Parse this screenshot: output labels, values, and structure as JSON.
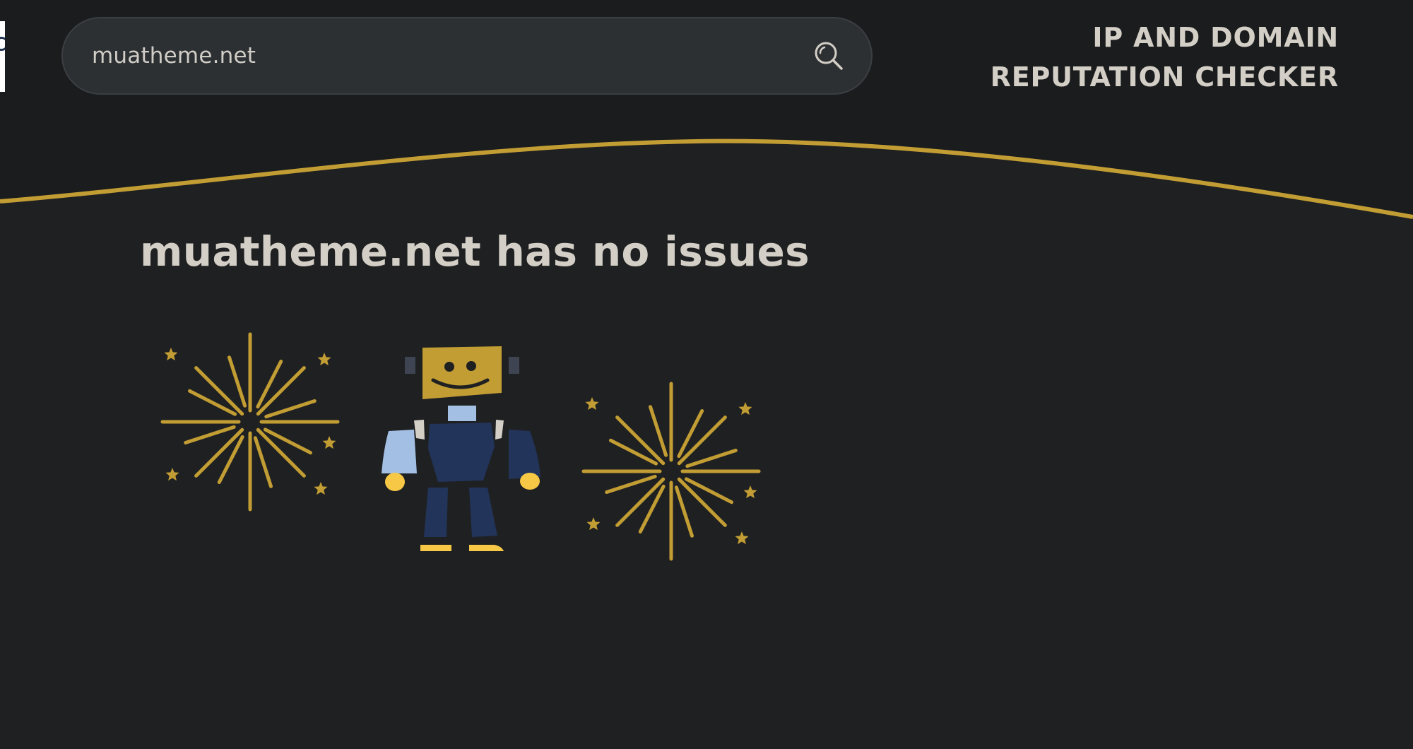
{
  "search": {
    "value": "muatheme.net",
    "placeholder": "",
    "button_icon": "search-icon"
  },
  "header": {
    "title_line1": "IP AND DOMAIN",
    "title_line2": "REPUTATION CHECKER"
  },
  "result": {
    "heading": "muatheme.net has no issues"
  },
  "illustration": {
    "subject": "robot-mascot-with-fireworks"
  },
  "colors": {
    "background": "#1f2022",
    "header_background": "#1b1c1e",
    "accent_gold": "#c29d34",
    "text": "#d3cec6",
    "search_background": "#2d3033",
    "robot_body": "#22345a",
    "robot_arm": "#a3c0e4",
    "robot_hands": "#f6c845"
  }
}
